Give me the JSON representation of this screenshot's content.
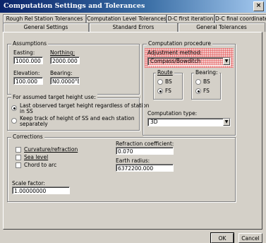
{
  "window": {
    "title": "Computation Settings and Tolerances",
    "close": "×"
  },
  "tabs": {
    "row1": [
      "Rough Rel Station Tolerances",
      "Computation Level Tolerances",
      "D-C first iteration",
      "D-C final coordinates"
    ],
    "row2": [
      "General Settings",
      "Standard Errors",
      "General Tolerances"
    ],
    "active": "General Settings"
  },
  "assumptions": {
    "label": "Assumptions",
    "easting": {
      "label": "Easting:",
      "value": "1000.000"
    },
    "northing": {
      "label": "Northing:",
      "value": "2000.000"
    },
    "elevation": {
      "label": "Elevation:",
      "value": "100.000"
    },
    "bearing": {
      "label": "Bearing:",
      "value": "N0.0000°E"
    }
  },
  "height": {
    "label": "For assumed target height use:",
    "opt1": "Last observed target height regardless of station",
    "opt1b": "in SS",
    "opt2": "Keep track of height of SS and each station",
    "opt2b": "separately"
  },
  "procedure": {
    "label": "Computation procedure",
    "adj_label": "Adjustment method:",
    "adj_value": "Compass/Bowditch",
    "route": {
      "label": "Route",
      "bs": "BS",
      "fs": "FS"
    },
    "bearing": {
      "label": "Bearing:",
      "bs": "BS",
      "fs": "FS"
    },
    "type_label": "Computation type:",
    "type_value": "3D"
  },
  "corrections": {
    "label": "Corrections",
    "curvature": "Curvature/refraction",
    "sealevel": "Sea level",
    "chord": "Chord to arc",
    "refraction_label": "Refraction coefficient:",
    "refraction_value": "0.070",
    "earth_label": "Earth radius:",
    "earth_value": "6372200.000",
    "scale_label": "Scale factor:",
    "scale_value": "1.00000000"
  },
  "buttons": {
    "ok": "OK",
    "cancel": "Cancel"
  }
}
